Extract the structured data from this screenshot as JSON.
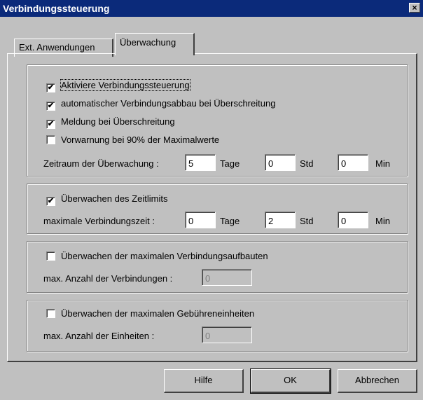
{
  "window": {
    "title": "Verbindungssteuerung",
    "close_glyph": "×"
  },
  "tabs": [
    {
      "label": "Ext. Anwendungen",
      "active": false
    },
    {
      "label": "Überwachung",
      "active": true
    }
  ],
  "group1": {
    "checkboxes": [
      {
        "label": "Aktiviere Verbindungssteuerung",
        "checked": true
      },
      {
        "label": "automatischer Verbindungsabbau bei Überschreitung",
        "checked": true
      },
      {
        "label": "Meldung bei Überschreitung",
        "checked": true
      },
      {
        "label": "Vorwarnung bei 90% der Maximalwerte",
        "checked": false
      }
    ],
    "period_label": "Zeitraum der Überwachung :",
    "days": {
      "value": "5",
      "unit": "Tage"
    },
    "hours": {
      "value": "0",
      "unit": "Std"
    },
    "minutes": {
      "value": "0",
      "unit": "Min"
    }
  },
  "group2": {
    "checkbox": {
      "label": "Überwachen des Zeitlimits",
      "checked": true
    },
    "max_label": "maximale Verbindungszeit :",
    "days": {
      "value": "0",
      "unit": "Tage"
    },
    "hours": {
      "value": "2",
      "unit": "Std"
    },
    "minutes": {
      "value": "0",
      "unit": "Min"
    }
  },
  "group3": {
    "checkbox": {
      "label": "Überwachen der maximalen Verbindungsaufbauten",
      "checked": false
    },
    "count_label": "max. Anzahl der Verbindungen :",
    "count_value": "0"
  },
  "group4": {
    "checkbox": {
      "label": "Überwachen der maximalen Gebühreneinheiten",
      "checked": false
    },
    "count_label": "max. Anzahl der Einheiten :",
    "count_value": "0"
  },
  "buttons": {
    "help": "Hilfe",
    "ok": "OK",
    "cancel": "Abbrechen"
  },
  "check_glyph": "✔"
}
